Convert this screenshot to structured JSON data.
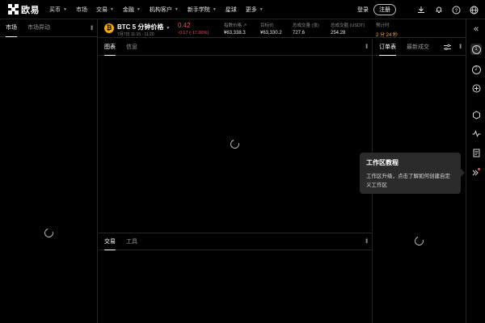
{
  "topnav": {
    "logo_text": "欧易",
    "items": [
      {
        "label": "买币",
        "dropdown": true
      },
      {
        "label": "市场",
        "dropdown": false
      },
      {
        "label": "交易",
        "dropdown": true
      },
      {
        "label": "金融",
        "dropdown": true
      },
      {
        "label": "机构客户",
        "dropdown": true
      },
      {
        "label": "新手学院",
        "dropdown": true
      },
      {
        "label": "星球",
        "dropdown": false
      },
      {
        "label": "更多",
        "dropdown": true
      }
    ],
    "login": "登录",
    "register": "注册",
    "icons": [
      "download-icon",
      "bell-icon",
      "help-icon",
      "globe-icon"
    ]
  },
  "market": {
    "tabs": [
      "市场",
      "市场异动"
    ]
  },
  "ticker": {
    "pair": "BTC 5 分钟价格",
    "sub": "7月7日 11:15 - 11:20",
    "last_price": "0.42",
    "change": "-0.17 (-17.00%)",
    "stats": [
      {
        "label": "指数价格 ↗",
        "value": "¥63,338.3"
      },
      {
        "label": "目标价",
        "value": "¥63,330.2"
      },
      {
        "label": "总成交量 (张)",
        "value": "727.6"
      },
      {
        "label": "总成交额 (USDT)",
        "value": "254.28"
      },
      {
        "label": "预计时",
        "value": "2 分 24 秒"
      }
    ]
  },
  "chart_panel": {
    "tabs": [
      "图表",
      "信息"
    ]
  },
  "trade_panel": {
    "tabs": [
      "交易",
      "工具"
    ]
  },
  "orderbook": {
    "tabs": [
      "订单表",
      "最新成交"
    ]
  },
  "rightbar": {
    "collapse_icon": "«",
    "step1": "1",
    "step2": "2"
  },
  "tooltip": {
    "title": "工作区教程",
    "body": "工作区升级，点击了解如何创建自定义工作区"
  },
  "colors": {
    "accent_red": "#e8555e",
    "btc_orange": "#f2a900",
    "countdown_orange": "#f0a830"
  }
}
